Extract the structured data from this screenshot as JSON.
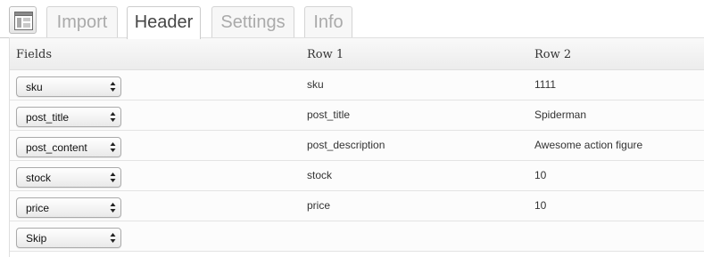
{
  "tabs": [
    {
      "label": "Import",
      "active": false
    },
    {
      "label": "Header",
      "active": true
    },
    {
      "label": "Settings",
      "active": false
    },
    {
      "label": "Info",
      "active": false
    }
  ],
  "table": {
    "headers": {
      "fields": "Fields",
      "row1": "Row 1",
      "row2": "Row 2"
    },
    "rows": [
      {
        "field": "sku",
        "row1": "sku",
        "row2": "1111"
      },
      {
        "field": "post_title",
        "row1": "post_title",
        "row2": "Spiderman"
      },
      {
        "field": "post_content",
        "row1": "post_description",
        "row2": "Awesome action figure"
      },
      {
        "field": "stock",
        "row1": "stock",
        "row2": "10"
      },
      {
        "field": "price",
        "row1": "price",
        "row2": "10"
      },
      {
        "field": "Skip",
        "row1": "",
        "row2": ""
      }
    ]
  },
  "icons": {
    "app": "plugin-screen-icon",
    "select_arrows": "up-down-arrows-icon"
  }
}
